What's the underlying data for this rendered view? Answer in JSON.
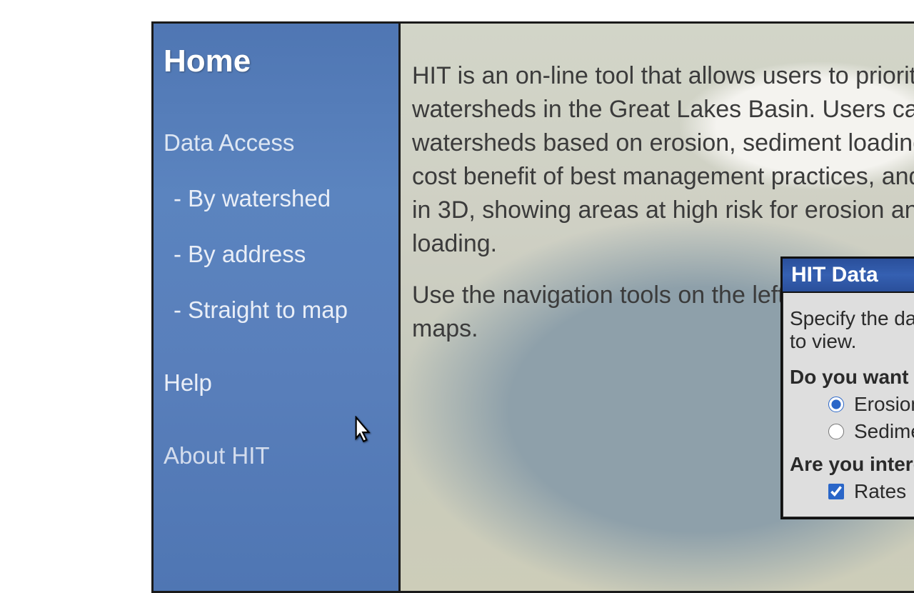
{
  "sidebar": {
    "home": "Home",
    "data_access_label": "Data Access",
    "items": [
      {
        "label": "By watershed"
      },
      {
        "label": "By address"
      },
      {
        "label": "Straight to map"
      }
    ],
    "help": "Help",
    "about": "About HIT"
  },
  "content": {
    "p1": "HIT is an on-line tool that allows users to prioritize watersheds in the Great Lakes Basin. Users can compare watersheds based on erosion, sediment loading, and the cost benefit of best management practices, and view terrain in 3D, showing areas at high risk for erosion and sediment loading.",
    "p2": "Use the navigation tools on the left to access HIT data and maps."
  },
  "panel": {
    "title": "HIT Data",
    "intro": "Specify the data you would like to view.",
    "q1": "Do you want to view:",
    "opt_erosion": "Erosion",
    "opt_sediment": "Sediment",
    "q2": "Are you interested in:",
    "opt_rates": "Rates",
    "radio_selected": "erosion",
    "rates_checked": true
  }
}
